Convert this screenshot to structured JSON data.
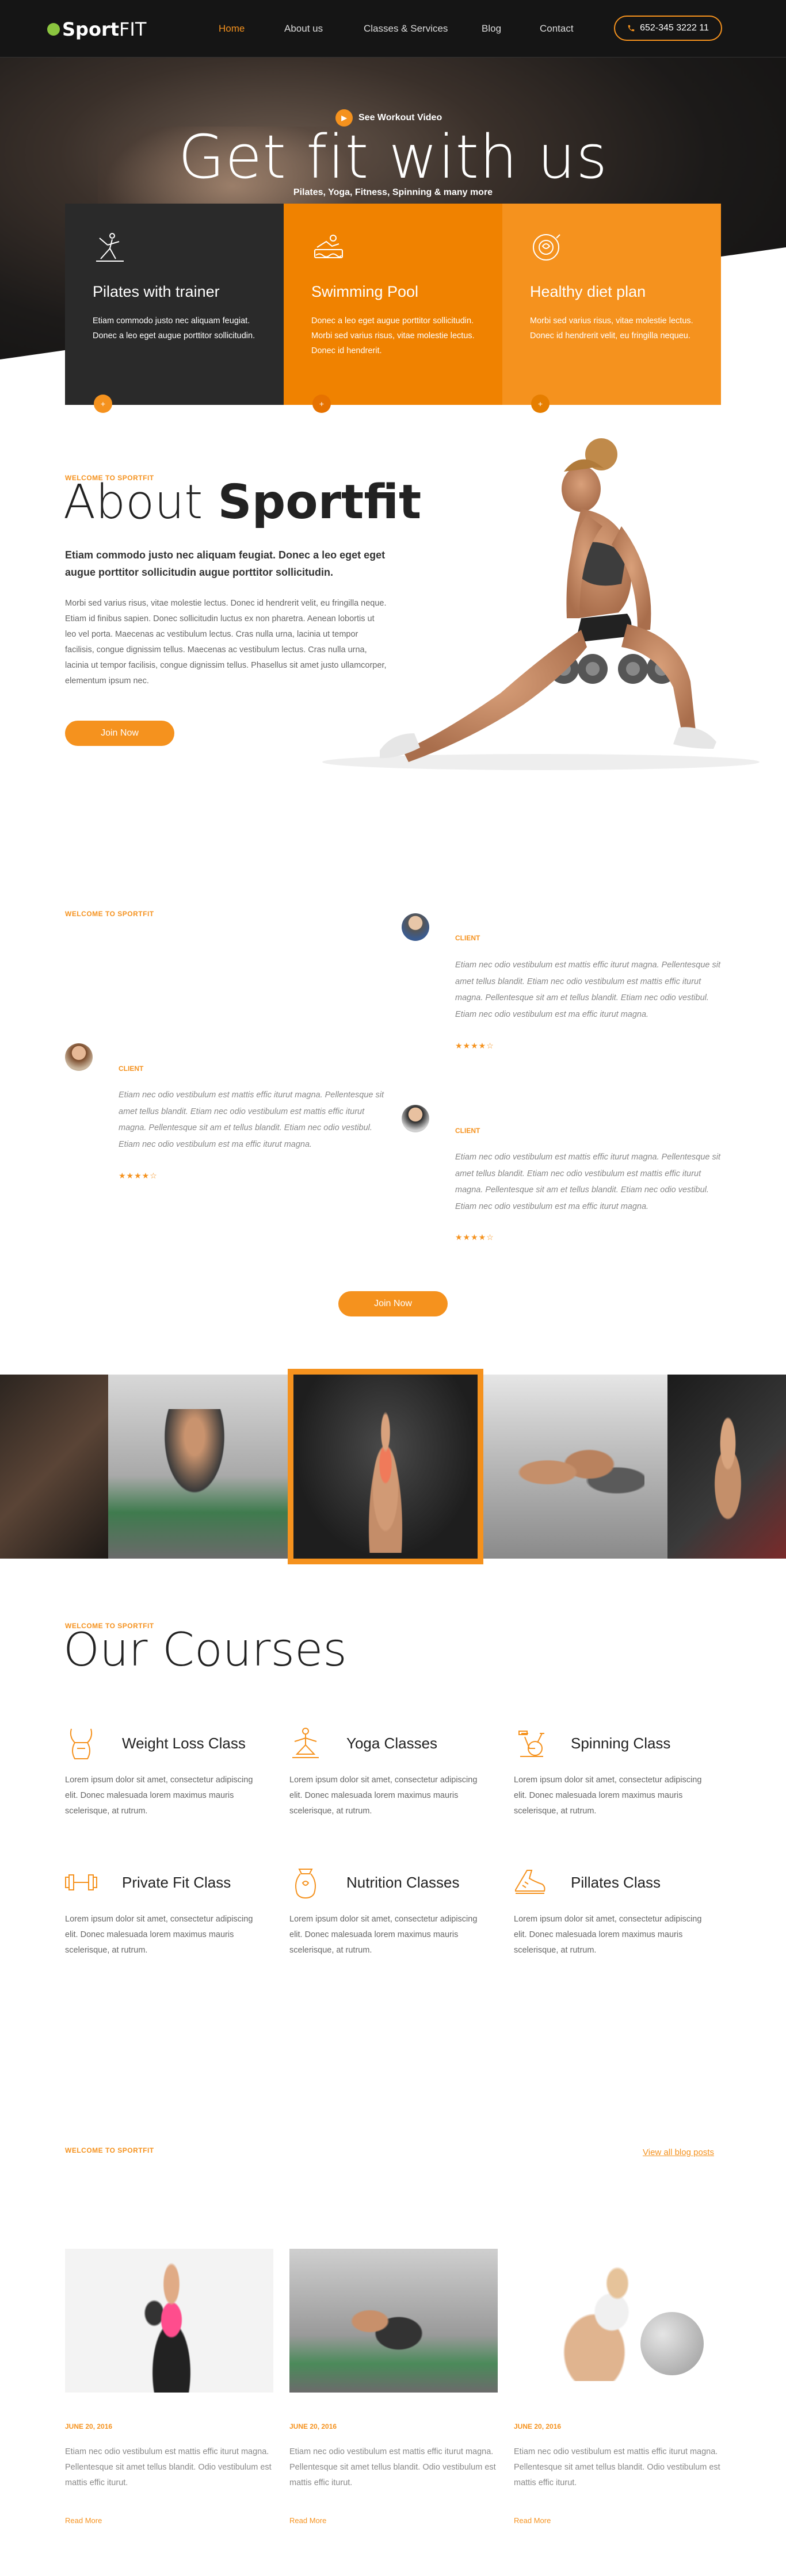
{
  "header": {
    "logo_sport": "Sport",
    "logo_fit": "FIT",
    "nav": [
      "Home",
      "About us",
      "Classes & Services",
      "Blog",
      "Contact"
    ],
    "phone": "652-345 3222 11"
  },
  "hero": {
    "video_label": "See Workout Video",
    "title": "Get fit with us",
    "subtitle": "Pilates, Yoga, Fitness, Spinning & many more"
  },
  "features": [
    {
      "title": "Pilates with trainer",
      "text": "Etiam commodo justo nec aliquam feugiat. Donec a leo eget augue porttitor sollicitudin.",
      "icon": "pilates-icon"
    },
    {
      "title": "Swimming Pool",
      "text": "Donec a leo eget augue porttitor sollicitudin. Morbi sed varius risus, vitae molestie lectus. Donec id hendrerit.",
      "icon": "swimming-pool-icon"
    },
    {
      "title": "Healthy diet plan",
      "text": "Morbi sed varius risus, vitae molestie lectus. Donec id hendrerit velit, eu fringilla nequeu.",
      "icon": "diet-plan-icon"
    }
  ],
  "about": {
    "label": "WELCOME TO SPORTFIT",
    "title_light": "About",
    "title_bold": "Sportfit",
    "lead": "Etiam commodo justo nec aliquam feugiat. Donec a leo eget eget augue porttitor sollicitudin augue porttitor sollicitudin.",
    "body": "Morbi sed varius risus, vitae molestie lectus. Donec id hendrerit velit, eu fringilla neque. Etiam id finibus sapien. Donec sollicitudin luctus ex non pharetra. Aenean lobortis ut leo vel porta. Maecenas ac vestibulum lectus. Cras nulla urna, lacinia ut tempor facilisis, congue dignissim tellus. Maecenas ac vestibulum lectus. Cras nulla urna, lacinia ut tempor facilisis, congue dignissim tellus. Phasellus sit amet justo ullamcorper, elementum ipsum nec.",
    "button": "Join Now"
  },
  "testimonials": {
    "label": "WELCOME TO SPORTFIT",
    "items": [
      {
        "client": "CLIENT",
        "text": "Etiam nec odio vestibulum est mattis effic iturut magna. Pellentesque sit amet tellus blandit. Etiam nec odio vestibulum est mattis effic iturut magna. Pellentesque sit am et tellus blandit. Etiam nec odio vestibul. Etiam nec odio vestibulum est ma effic iturut magna.",
        "stars": "★★★★☆"
      },
      {
        "client": "CLIENT",
        "text": "Etiam nec odio vestibulum est mattis effic iturut magna. Pellentesque sit amet tellus blandit. Etiam nec odio vestibulum est mattis effic iturut magna. Pellentesque sit am et tellus blandit. Etiam nec odio vestibul. Etiam nec odio vestibulum est ma effic iturut magna.",
        "stars": "★★★★☆"
      },
      {
        "client": "CLIENT",
        "text": "Etiam nec odio vestibulum est mattis effic iturut magna. Pellentesque sit amet tellus blandit. Etiam nec odio vestibulum est mattis effic iturut magna. Pellentesque sit am et tellus blandit. Etiam nec odio vestibul. Etiam nec odio vestibulum est ma effic iturut magna.",
        "stars": "★★★★☆"
      }
    ],
    "button": "Join Now"
  },
  "courses": {
    "label": "WELCOME TO SPORTFIT",
    "title": "Our Courses",
    "items": [
      {
        "title": "Weight Loss Class",
        "text": "Lorem ipsum dolor sit amet, consectetur adipiscing elit. Donec malesuada lorem maximus mauris scelerisque, at rutrum.",
        "icon": "weight-loss-icon"
      },
      {
        "title": "Yoga Classes",
        "text": "Lorem ipsum dolor sit amet, consectetur adipiscing elit. Donec malesuada lorem maximus mauris scelerisque, at rutrum.",
        "icon": "yoga-icon"
      },
      {
        "title": "Spinning Class",
        "text": "Lorem ipsum dolor sit amet, consectetur adipiscing elit. Donec malesuada lorem maximus mauris scelerisque, at rutrum.",
        "icon": "spinning-bike-icon"
      },
      {
        "title": "Private Fit Class",
        "text": "Lorem ipsum dolor sit amet, consectetur adipiscing elit. Donec malesuada lorem maximus mauris scelerisque, at rutrum.",
        "icon": "dumbbell-icon"
      },
      {
        "title": "Nutrition Classes",
        "text": "Lorem ipsum dolor sit amet, consectetur adipiscing elit. Donec malesuada lorem maximus mauris scelerisque, at rutrum.",
        "icon": "nutrition-icon"
      },
      {
        "title": "Pillates Class",
        "text": "Lorem ipsum dolor sit amet, consectetur adipiscing elit. Donec malesuada lorem maximus mauris scelerisque, at rutrum.",
        "icon": "pilates-shoe-icon"
      }
    ]
  },
  "blog": {
    "label": "WELCOME TO SPORTFIT",
    "view_all": "View all blog posts",
    "posts": [
      {
        "date": "JUNE 20, 2016",
        "text": "Etiam nec odio vestibulum est mattis effic iturut magna. Pellentesque sit amet tellus blandit. Odio vestibulum est mattis effic iturut.",
        "more": "Read More"
      },
      {
        "date": "JUNE 20, 2016",
        "text": "Etiam nec odio vestibulum est mattis effic iturut magna. Pellentesque sit amet tellus blandit. Odio vestibulum est mattis effic iturut.",
        "more": "Read More"
      },
      {
        "date": "JUNE 20, 2016",
        "text": "Etiam nec odio vestibulum est mattis effic iturut magna. Pellentesque sit amet tellus blandit. Odio vestibulum est mattis effic iturut.",
        "more": "Read More"
      }
    ]
  },
  "colors": {
    "accent": "#f5921e",
    "dark": "#151515",
    "feature_dark": "#2a2a2a",
    "feature_mid": "#f08200"
  }
}
